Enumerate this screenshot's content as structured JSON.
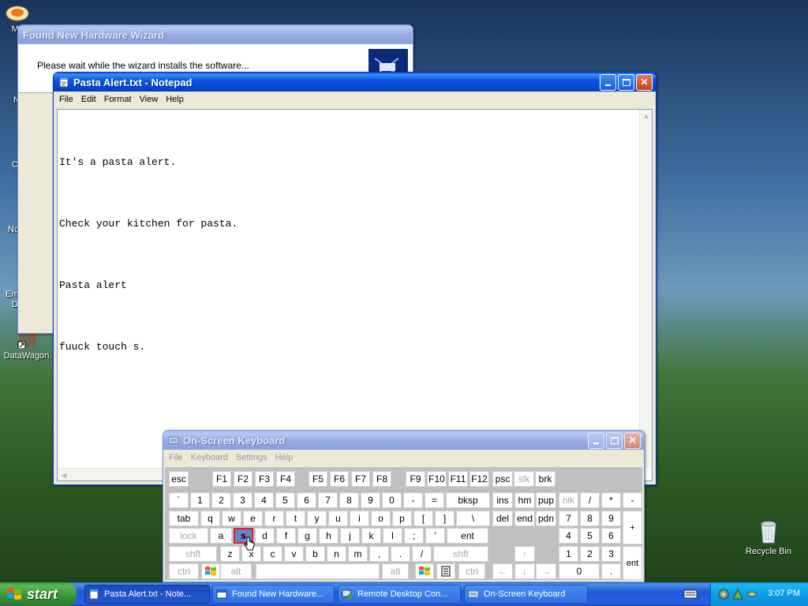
{
  "desktop": {
    "icons": [
      {
        "label": "My",
        "icon": "my-computer-icon"
      },
      {
        "label": "N",
        "icon": "desktop-icon"
      },
      {
        "label": "C",
        "icon": "desktop-icon"
      },
      {
        "label": "No",
        "icon": "desktop-icon"
      },
      {
        "label": "Em",
        "icon": "desktop-icon"
      },
      {
        "label": "D",
        "icon": "desktop-icon"
      },
      {
        "label": "DataWagon.",
        "icon": "shortcut-icon"
      },
      {
        "label": "Recycle Bin",
        "icon": "recycle-bin-icon"
      }
    ]
  },
  "wizard": {
    "title": "Found New Hardware Wizard",
    "message": "Please wait while the wizard installs the software..."
  },
  "notepad": {
    "title": "Pasta Alert.txt - Notepad",
    "menu": [
      "File",
      "Edit",
      "Format",
      "View",
      "Help"
    ],
    "lines": [
      "It's a pasta alert.",
      "Check your kitchen for pasta.",
      "Pasta alert",
      "fuuck touch s."
    ]
  },
  "osk": {
    "title": "On-Screen Keyboard",
    "menu": [
      "File",
      "Keyboard",
      "Settings",
      "Help"
    ],
    "pressed_key": "s",
    "rows": {
      "fn": [
        "esc",
        "F1",
        "F2",
        "F3",
        "F4",
        "F5",
        "F6",
        "F7",
        "F8",
        "F9",
        "F10",
        "F11",
        "F12",
        "psc",
        "slk",
        "brk"
      ],
      "num": [
        "`",
        "1",
        "2",
        "3",
        "4",
        "5",
        "6",
        "7",
        "8",
        "9",
        "0",
        "-",
        "=",
        "bksp",
        "ins",
        "hm",
        "pup",
        "nlk",
        "/",
        "*",
        "-"
      ],
      "top": [
        "tab",
        "q",
        "w",
        "e",
        "r",
        "t",
        "y",
        "u",
        "i",
        "o",
        "p",
        "[",
        "]",
        "\\",
        "del",
        "end",
        "pdn",
        "7",
        "8",
        "9",
        "+"
      ],
      "home": [
        "lock",
        "a",
        "s",
        "d",
        "f",
        "g",
        "h",
        "j",
        "k",
        "l",
        ";",
        "'",
        "ent",
        "4",
        "5",
        "6"
      ],
      "bottom": [
        "shft",
        "z",
        "x",
        "c",
        "v",
        "b",
        "n",
        "m",
        ",",
        ".",
        "/",
        "shft",
        "↑",
        "1",
        "2",
        "3",
        "ent"
      ],
      "space": [
        "ctrl",
        "alt",
        "alt",
        "ctrl",
        "←",
        "↓",
        "→",
        "0",
        "."
      ]
    }
  },
  "taskbar": {
    "start_label": "start",
    "tasks": [
      "Pasta Alert.txt - Note...",
      "Found New Hardware...",
      "Remote Desktop Con...",
      "On-Screen Keyboard"
    ],
    "clock": "3:07 PM"
  },
  "colors": {
    "title_active": "#0343cd",
    "pressed_key": "#6f7fc8",
    "pressed_border": "#e02020"
  }
}
